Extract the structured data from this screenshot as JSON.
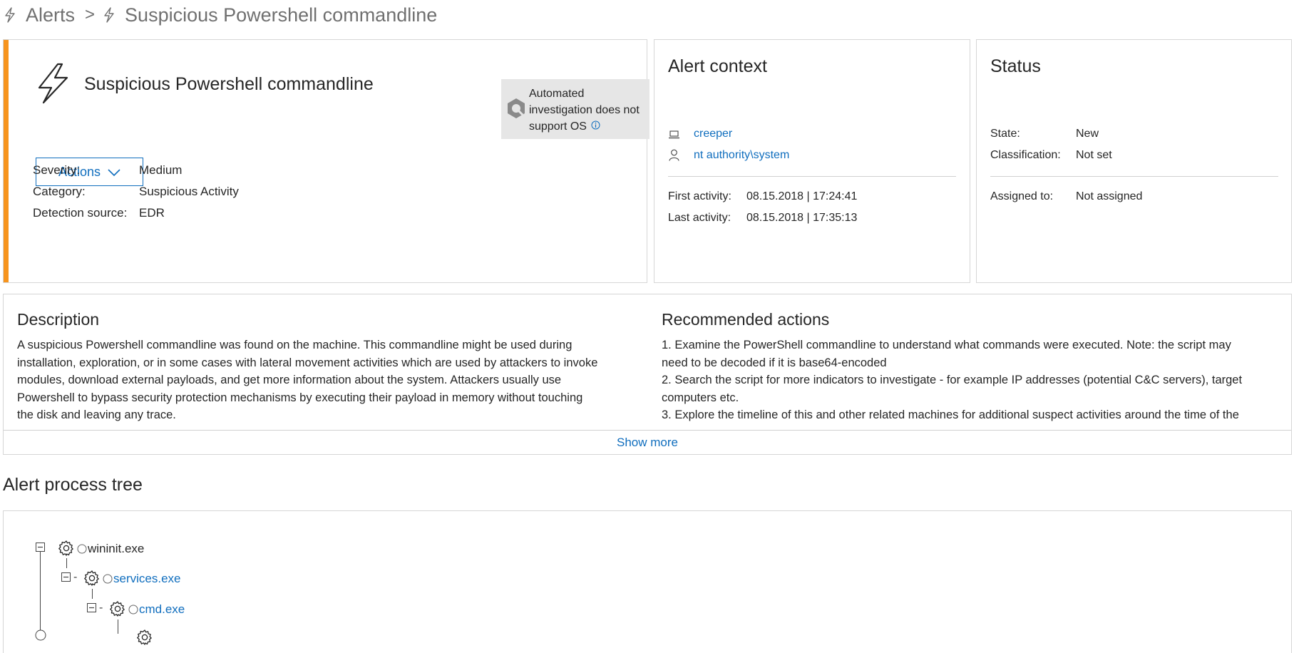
{
  "breadcrumb": {
    "items": [
      "Alerts",
      "Suspicious Powershell commandline"
    ],
    "separator": ">"
  },
  "alert": {
    "title": "Suspicious Powershell commandline",
    "accent_color": "#f7941d",
    "actions_label": "Actions",
    "automated_investigation": [
      "Automated",
      "investigation does not",
      "support OS"
    ],
    "fields": [
      {
        "label": "Severity:",
        "value": "Medium"
      },
      {
        "label": "Category:",
        "value": "Suspicious Activity"
      },
      {
        "label": "Detection source:",
        "value": "EDR"
      }
    ]
  },
  "context": {
    "title": "Alert context",
    "machine": "creeper",
    "user": "nt authority\\system",
    "first_label": "First activity:",
    "first_value": "08.15.2018 | 17:24:41",
    "last_label": "Last activity:",
    "last_value": "08.15.2018 | 17:35:13"
  },
  "status": {
    "title": "Status",
    "state_label": "State:",
    "state_value": "New",
    "classification_label": "Classification:",
    "classification_value": "Not set",
    "assigned_label": "Assigned to:",
    "assigned_value": "Not assigned"
  },
  "description": {
    "title": "Description",
    "lines": [
      "A suspicious Powershell commandline was found on the machine. This commandline might be used during",
      "installation, exploration, or in some cases with lateral movement activities which are used by attackers to invoke",
      "modules, download external payloads, and get more information about the system. Attackers usually use",
      "Powershell to bypass security protection mechanisms by executing their payload in memory without touching",
      "the disk and leaving any trace."
    ]
  },
  "recommended": {
    "title": "Recommended actions",
    "lines": [
      "1. Examine the PowerShell commandline to understand what commands were executed. Note: the script may",
      "need to be decoded if it is base64-encoded",
      "2. Search the script for more indicators to investigate - for example IP addresses (potential C&C servers), target",
      "computers etc.",
      "3. Explore the timeline of this and other related machines for additional suspect activities around the time of the"
    ]
  },
  "show_more": "Show more",
  "process_tree": {
    "title": "Alert process tree",
    "nodes": [
      {
        "name": "wininit.exe",
        "linked": false
      },
      {
        "name": "services.exe",
        "linked": true
      },
      {
        "name": "cmd.exe",
        "linked": true
      }
    ]
  }
}
